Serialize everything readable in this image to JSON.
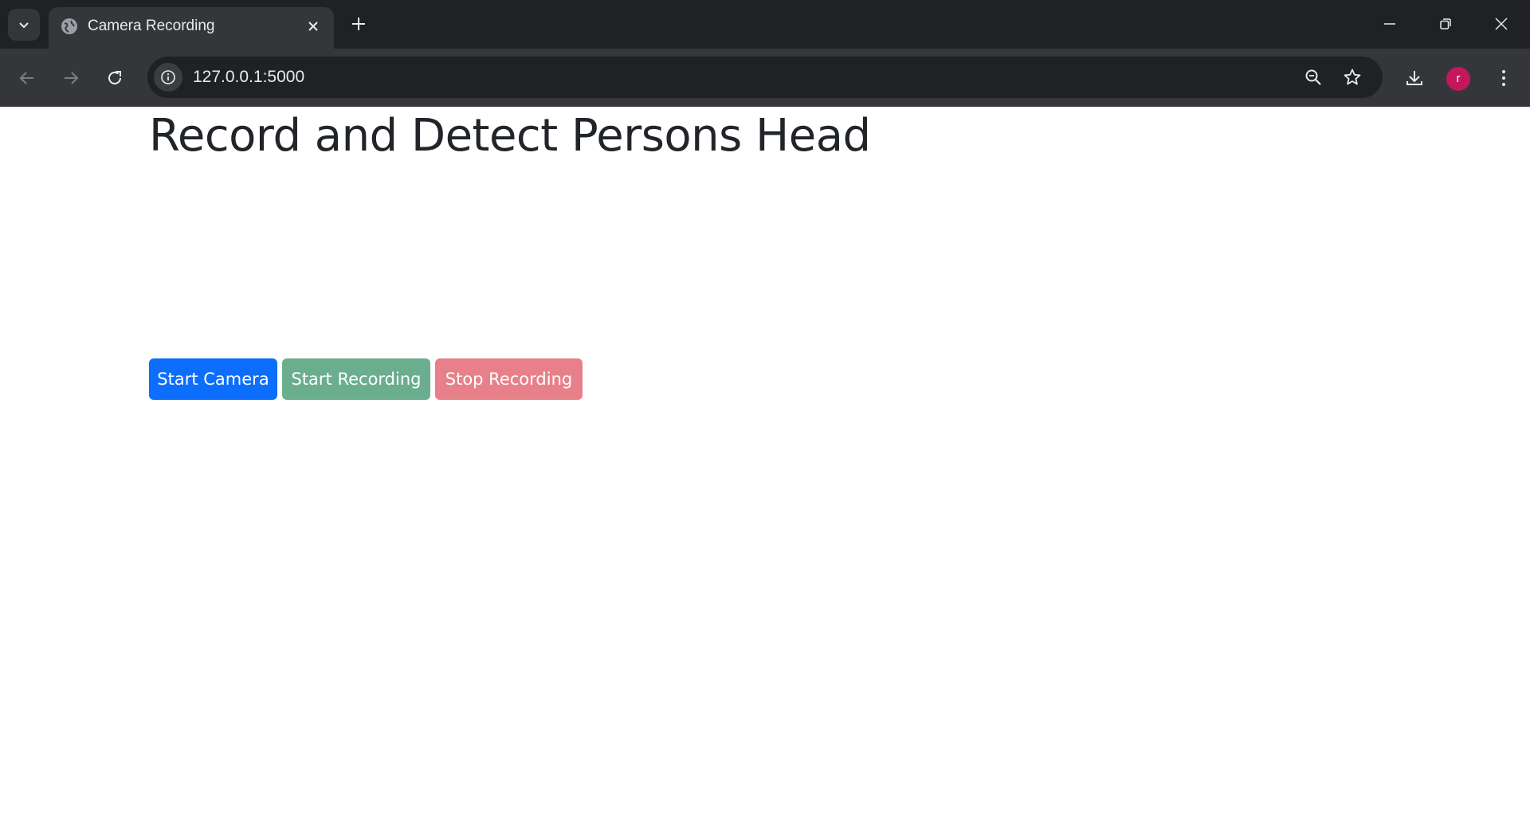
{
  "browser": {
    "tab": {
      "title": "Camera Recording"
    },
    "address_bar": {
      "url": "127.0.0.1:5000"
    },
    "profile": {
      "initial": "r",
      "color": "#c2185b"
    },
    "icons": {
      "tab_search": "chevron-down-icon",
      "favicon": "globe-icon",
      "tab_close": "close-icon",
      "new_tab": "plus-icon",
      "back": "arrow-left-icon",
      "forward": "arrow-right-icon",
      "reload": "reload-icon",
      "site_info": "info-icon",
      "zoom": "zoom-icon",
      "bookmark": "star-icon",
      "downloads": "download-icon",
      "menu": "kebab-menu-icon",
      "minimize": "minimize-icon",
      "restore": "restore-icon",
      "close_window": "close-icon"
    }
  },
  "page": {
    "title": "Record and Detect Persons Head",
    "buttons": {
      "start_camera": "Start Camera",
      "start_recording": "Start Recording",
      "stop_recording": "Stop Recording"
    },
    "colors": {
      "primary": "#0d6efd",
      "success_disabled": "#6aae8e",
      "danger_disabled": "#e8808a"
    }
  }
}
